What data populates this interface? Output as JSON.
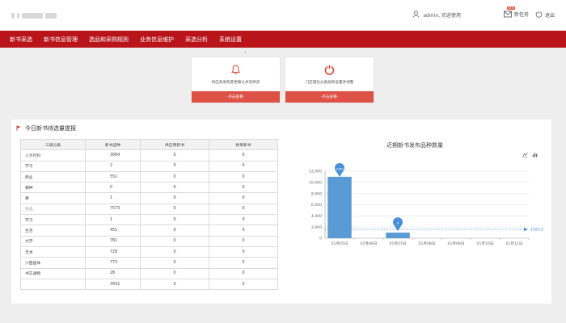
{
  "header": {
    "user_text": "admin, 欢迎使用",
    "notice_badge": "NEW",
    "notice_label": "新任务",
    "logout_label": "退出"
  },
  "nav": {
    "items": [
      "新书采选",
      "新书信息管理",
      "选品和采购规则",
      "业务信息维护",
      "采选分析",
      "系统设置"
    ]
  },
  "cards": [
    {
      "icon": "bell-icon",
      "text": "供应商采购变更确认并向供货",
      "button": "-点击查看-"
    },
    {
      "icon": "power-icon",
      "text": "门店量化分类规则设置并调整",
      "button": "-点击查看-"
    }
  ],
  "panel": {
    "title": "今日新书待选量提报"
  },
  "table": {
    "headers": [
      "三级分类",
      "新书品种",
      "供应商新书",
      "拼单新书"
    ],
    "rows": [
      [
        "人文社科",
        "3064",
        "0",
        "0"
      ],
      [
        "学习",
        "2",
        "0",
        "0"
      ],
      [
        "商业",
        "551",
        "0",
        "0"
      ],
      [
        "哪种",
        "0",
        "0",
        "0"
      ],
      [
        "哪",
        "1",
        "0",
        "0"
      ],
      [
        "少儿",
        "7573",
        "0",
        "0"
      ],
      [
        "学习",
        "1",
        "0",
        "0"
      ],
      [
        "生活",
        "451",
        "0",
        "0"
      ],
      [
        "文学",
        "781",
        "0",
        "0"
      ],
      [
        "艺术",
        "728",
        "0",
        "0"
      ],
      [
        "少图画体",
        "773",
        "0",
        "0"
      ],
      [
        "书交通物",
        "28",
        "0",
        "0"
      ],
      [
        "",
        "3432",
        "0",
        "0"
      ]
    ]
  },
  "chart_data": {
    "type": "bar",
    "title": "近期新书发布品种数量",
    "categories": [
      "01月05日",
      "01月06日",
      "01月07日",
      "01月08日",
      "01月09日",
      "01月10日",
      "01月11日"
    ],
    "values": [
      11000,
      0,
      1000,
      0,
      0,
      0,
      0
    ],
    "ylim": [
      0,
      12000
    ],
    "yticks": [
      "0",
      "2,000",
      "4,000",
      "6,000",
      "8,000",
      "10,000",
      "12,000"
    ],
    "markpoints": [
      {
        "category": "01月05日",
        "label": "1050"
      },
      {
        "category": "01月07日",
        "label": "0"
      }
    ],
    "markline_label": "1583.57",
    "markline_value": 1583.57,
    "colors": {
      "bar": "#5b9bd5",
      "marker": "#4a90d9"
    }
  }
}
